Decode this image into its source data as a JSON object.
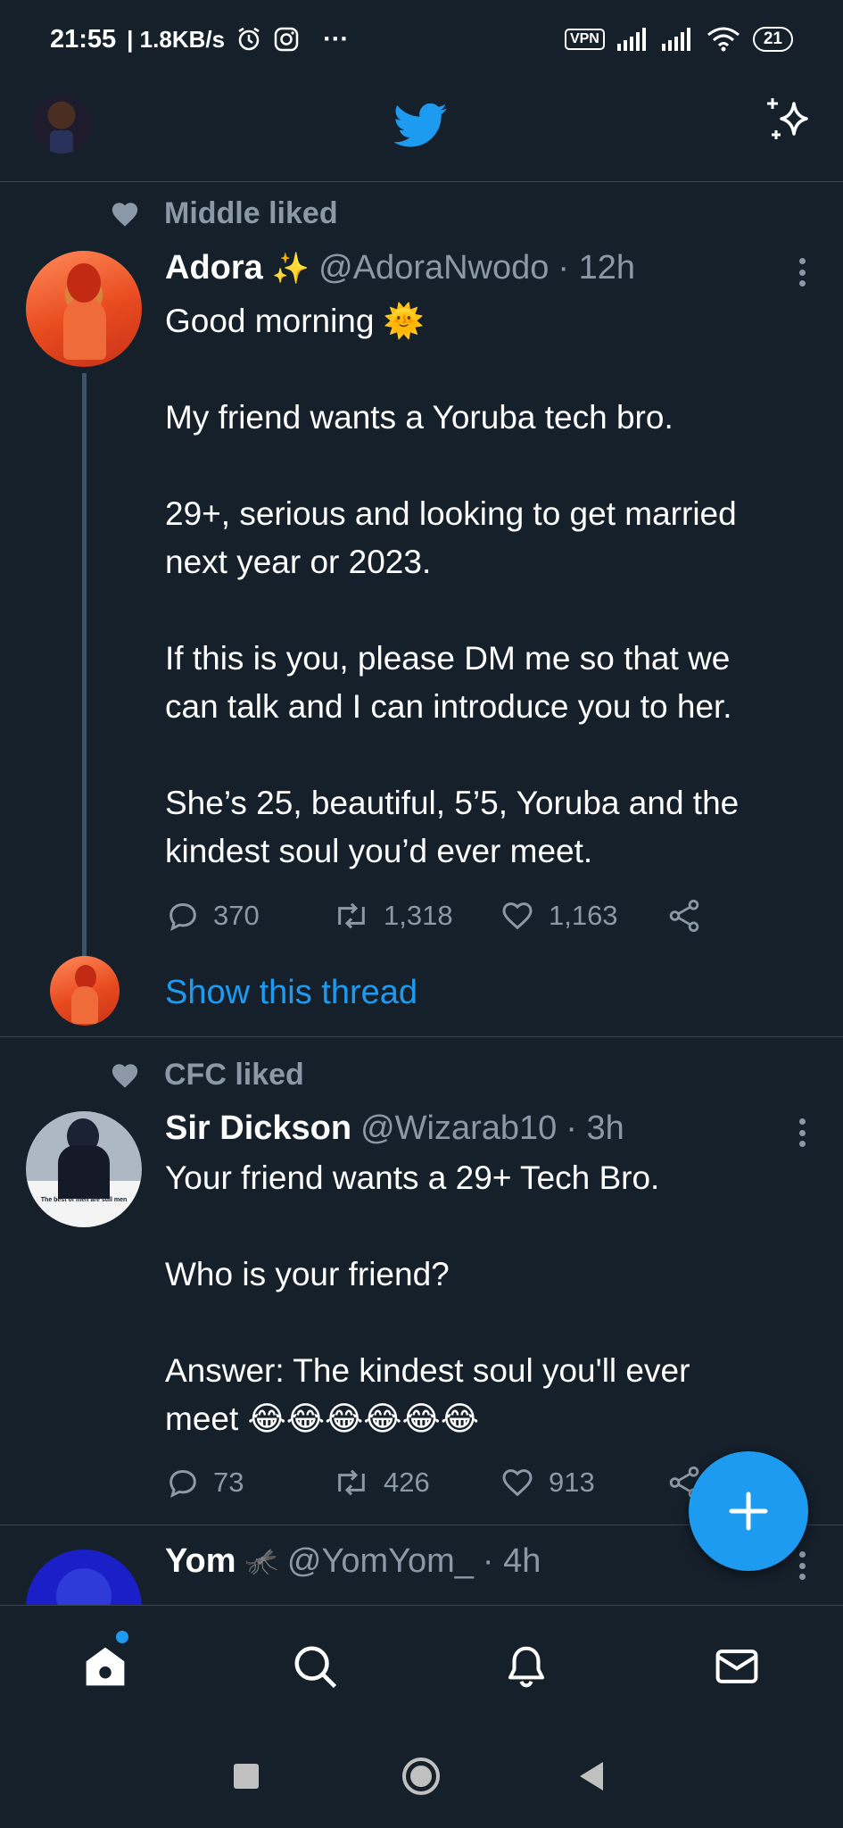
{
  "status_bar": {
    "time": "21:55",
    "speed": "| 1.8KB/s",
    "more": "···",
    "vpn": "VPN",
    "battery": "21"
  },
  "top_bar": {
    "profile_avatar": "avatar",
    "logo_icon": "twitter-bird-icon",
    "timeline_icon": "sparkle-icon",
    "accent": "#1d9bf0"
  },
  "tweets": [
    {
      "social_context": "Middle liked",
      "name": "Adora",
      "name_emoji": "✨",
      "handle": "@AdoraNwodo",
      "time": "· 12h",
      "lines": [
        "Good morning 🌞",
        "",
        "My friend wants a Yoruba tech bro.",
        "",
        "29+, serious and looking to get married",
        "next year or 2023.",
        "",
        "If this is you, please DM me so that we",
        "can talk and I can introduce you to her.",
        "",
        "She’s 25, beautiful, 5’5, Yoruba and the",
        "kindest soul you’d ever meet."
      ],
      "replies": "370",
      "retweets": "1,318",
      "likes": "1,163",
      "show_thread": "Show this thread"
    },
    {
      "social_context": "CFC liked",
      "name": "Sir Dickson",
      "handle": "@Wizarab10",
      "time": "· 3h",
      "avatar_caption": "The best of men are still men",
      "lines": [
        "Your friend wants a 29+ Tech Bro.",
        "",
        "Who is your friend?",
        "",
        "Answer: The kindest soul you'll ever",
        "meet 😂😂😂😂😂😂"
      ],
      "replies": "73",
      "retweets": "426",
      "likes": "913"
    },
    {
      "name": "Yom",
      "name_emoji": "🦟",
      "handle": "@YomYom_",
      "time": "· 4h"
    }
  ],
  "bottom_nav": {
    "items": [
      "home-icon",
      "search-icon",
      "notifications-icon",
      "messages-icon"
    ]
  },
  "fab": "compose-plus-icon"
}
